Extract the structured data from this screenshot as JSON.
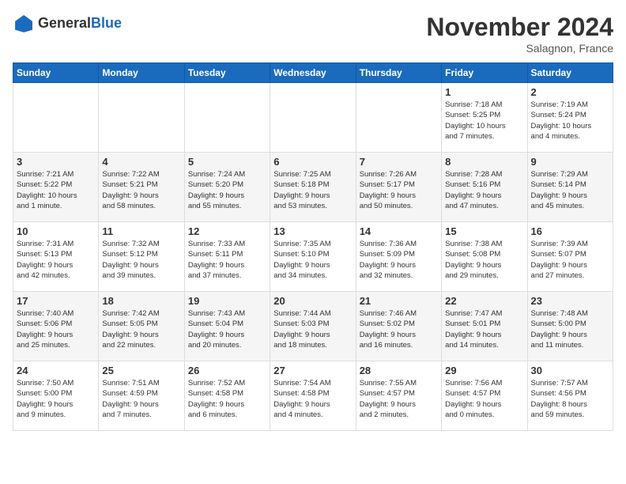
{
  "header": {
    "logo_line1": "General",
    "logo_line2": "Blue",
    "month": "November 2024",
    "location": "Salagnon, France"
  },
  "weekdays": [
    "Sunday",
    "Monday",
    "Tuesday",
    "Wednesday",
    "Thursday",
    "Friday",
    "Saturday"
  ],
  "weeks": [
    [
      {
        "day": "",
        "info": ""
      },
      {
        "day": "",
        "info": ""
      },
      {
        "day": "",
        "info": ""
      },
      {
        "day": "",
        "info": ""
      },
      {
        "day": "",
        "info": ""
      },
      {
        "day": "1",
        "info": "Sunrise: 7:18 AM\nSunset: 5:25 PM\nDaylight: 10 hours\nand 7 minutes."
      },
      {
        "day": "2",
        "info": "Sunrise: 7:19 AM\nSunset: 5:24 PM\nDaylight: 10 hours\nand 4 minutes."
      }
    ],
    [
      {
        "day": "3",
        "info": "Sunrise: 7:21 AM\nSunset: 5:22 PM\nDaylight: 10 hours\nand 1 minute."
      },
      {
        "day": "4",
        "info": "Sunrise: 7:22 AM\nSunset: 5:21 PM\nDaylight: 9 hours\nand 58 minutes."
      },
      {
        "day": "5",
        "info": "Sunrise: 7:24 AM\nSunset: 5:20 PM\nDaylight: 9 hours\nand 55 minutes."
      },
      {
        "day": "6",
        "info": "Sunrise: 7:25 AM\nSunset: 5:18 PM\nDaylight: 9 hours\nand 53 minutes."
      },
      {
        "day": "7",
        "info": "Sunrise: 7:26 AM\nSunset: 5:17 PM\nDaylight: 9 hours\nand 50 minutes."
      },
      {
        "day": "8",
        "info": "Sunrise: 7:28 AM\nSunset: 5:16 PM\nDaylight: 9 hours\nand 47 minutes."
      },
      {
        "day": "9",
        "info": "Sunrise: 7:29 AM\nSunset: 5:14 PM\nDaylight: 9 hours\nand 45 minutes."
      }
    ],
    [
      {
        "day": "10",
        "info": "Sunrise: 7:31 AM\nSunset: 5:13 PM\nDaylight: 9 hours\nand 42 minutes."
      },
      {
        "day": "11",
        "info": "Sunrise: 7:32 AM\nSunset: 5:12 PM\nDaylight: 9 hours\nand 39 minutes."
      },
      {
        "day": "12",
        "info": "Sunrise: 7:33 AM\nSunset: 5:11 PM\nDaylight: 9 hours\nand 37 minutes."
      },
      {
        "day": "13",
        "info": "Sunrise: 7:35 AM\nSunset: 5:10 PM\nDaylight: 9 hours\nand 34 minutes."
      },
      {
        "day": "14",
        "info": "Sunrise: 7:36 AM\nSunset: 5:09 PM\nDaylight: 9 hours\nand 32 minutes."
      },
      {
        "day": "15",
        "info": "Sunrise: 7:38 AM\nSunset: 5:08 PM\nDaylight: 9 hours\nand 29 minutes."
      },
      {
        "day": "16",
        "info": "Sunrise: 7:39 AM\nSunset: 5:07 PM\nDaylight: 9 hours\nand 27 minutes."
      }
    ],
    [
      {
        "day": "17",
        "info": "Sunrise: 7:40 AM\nSunset: 5:06 PM\nDaylight: 9 hours\nand 25 minutes."
      },
      {
        "day": "18",
        "info": "Sunrise: 7:42 AM\nSunset: 5:05 PM\nDaylight: 9 hours\nand 22 minutes."
      },
      {
        "day": "19",
        "info": "Sunrise: 7:43 AM\nSunset: 5:04 PM\nDaylight: 9 hours\nand 20 minutes."
      },
      {
        "day": "20",
        "info": "Sunrise: 7:44 AM\nSunset: 5:03 PM\nDaylight: 9 hours\nand 18 minutes."
      },
      {
        "day": "21",
        "info": "Sunrise: 7:46 AM\nSunset: 5:02 PM\nDaylight: 9 hours\nand 16 minutes."
      },
      {
        "day": "22",
        "info": "Sunrise: 7:47 AM\nSunset: 5:01 PM\nDaylight: 9 hours\nand 14 minutes."
      },
      {
        "day": "23",
        "info": "Sunrise: 7:48 AM\nSunset: 5:00 PM\nDaylight: 9 hours\nand 11 minutes."
      }
    ],
    [
      {
        "day": "24",
        "info": "Sunrise: 7:50 AM\nSunset: 5:00 PM\nDaylight: 9 hours\nand 9 minutes."
      },
      {
        "day": "25",
        "info": "Sunrise: 7:51 AM\nSunset: 4:59 PM\nDaylight: 9 hours\nand 7 minutes."
      },
      {
        "day": "26",
        "info": "Sunrise: 7:52 AM\nSunset: 4:58 PM\nDaylight: 9 hours\nand 6 minutes."
      },
      {
        "day": "27",
        "info": "Sunrise: 7:54 AM\nSunset: 4:58 PM\nDaylight: 9 hours\nand 4 minutes."
      },
      {
        "day": "28",
        "info": "Sunrise: 7:55 AM\nSunset: 4:57 PM\nDaylight: 9 hours\nand 2 minutes."
      },
      {
        "day": "29",
        "info": "Sunrise: 7:56 AM\nSunset: 4:57 PM\nDaylight: 9 hours\nand 0 minutes."
      },
      {
        "day": "30",
        "info": "Sunrise: 7:57 AM\nSunset: 4:56 PM\nDaylight: 8 hours\nand 59 minutes."
      }
    ]
  ]
}
